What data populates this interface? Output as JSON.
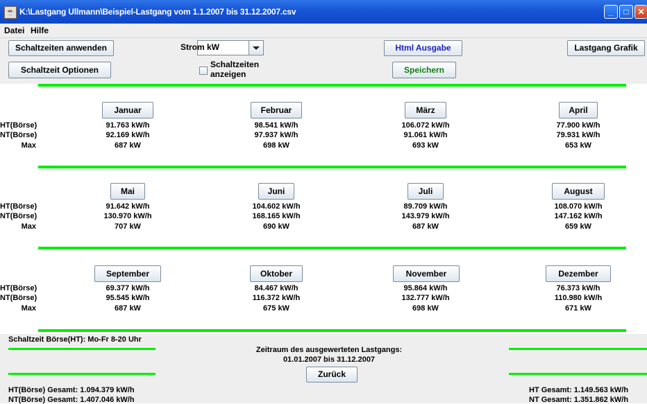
{
  "window": {
    "title": "K:\\Lastgang Ullmann\\Beispiel-Lastgang  vom 1.1.2007 bis 31.12.2007.csv",
    "app_icon": "java-icon"
  },
  "menu": [
    "Datei",
    "Hilfe"
  ],
  "toolbar": {
    "apply_label": "Schaltzeiten anwenden",
    "options_label": "Schaltzeit Optionen",
    "unit_select": "Strom kW",
    "show_times_label": "Schaltzeiten anzeigen",
    "show_times_checked": false,
    "html_label": "Html Ausgabe",
    "save_label": "Speichern",
    "graph_label": "Lastgang Grafik",
    "html_color": "#1a22c8",
    "save_color": "#137a13"
  },
  "row_labels": {
    "ht": "HT(Börse)",
    "nt": "NT(Börse)",
    "max": "Max"
  },
  "months": [
    {
      "name": "Januar",
      "ht": "91.763 kW/h",
      "nt": "92.169 kW/h",
      "max": "687 kW"
    },
    {
      "name": "Februar",
      "ht": "98.541 kW/h",
      "nt": "97.937 kW/h",
      "max": "698 kW"
    },
    {
      "name": "März",
      "ht": "106.072 kW/h",
      "nt": "91.061 kW/h",
      "max": "693 kW"
    },
    {
      "name": "April",
      "ht": "77.900 kW/h",
      "nt": "79.931 kW/h",
      "max": "653 kW"
    },
    {
      "name": "Mai",
      "ht": "91.642 kW/h",
      "nt": "130.970 kW/h",
      "max": "707 kW"
    },
    {
      "name": "Juni",
      "ht": "104.602 kW/h",
      "nt": "168.165 kW/h",
      "max": "690 kW"
    },
    {
      "name": "Juli",
      "ht": "89.709 kW/h",
      "nt": "143.979 kW/h",
      "max": "687 kW"
    },
    {
      "name": "August",
      "ht": "108.070 kW/h",
      "nt": "147.162 kW/h",
      "max": "659 kW"
    },
    {
      "name": "September",
      "ht": "69.377 kW/h",
      "nt": "95.545 kW/h",
      "max": "687 kW"
    },
    {
      "name": "Oktober",
      "ht": "84.467 kW/h",
      "nt": "116.372 kW/h",
      "max": "675 kW"
    },
    {
      "name": "November",
      "ht": "95.864 kW/h",
      "nt": "132.777 kW/h",
      "max": "698 kW"
    },
    {
      "name": "Dezember",
      "ht": "76.373 kW/h",
      "nt": "110.980 kW/h",
      "max": "671 kW"
    }
  ],
  "footer": {
    "schaltzeit": "Schaltzeit Börse(HT): Mo-Fr 8-20 Uhr",
    "zeitraum_label": "Zeitraum des ausgewerteten Lastgangs:",
    "zeitraum_value": "01.01.2007 bis 31.12.2007",
    "back_label": "Zurück",
    "ht_boerse_total": "HT(Börse) Gesamt: 1.094.379 kW/h",
    "nt_boerse_total": "NT(Börse) Gesamt: 1.407.046 kW/h",
    "ht_total": "HT Gesamt: 1.149.563 kW/h",
    "nt_total": "NT Gesamt: 1.351.862 kW/h"
  },
  "colors": {
    "separator": "#00ee00",
    "titlebar": "#1654d6"
  }
}
